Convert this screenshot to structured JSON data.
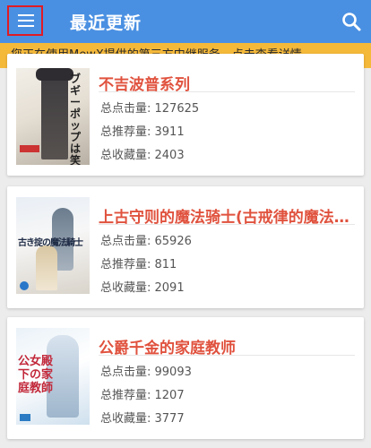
{
  "app": {
    "title": "最近更新"
  },
  "banner": {
    "text": "您正在使用MewX提供的第三方中继服务，点击查看详情。"
  },
  "labels": {
    "clicks": "总点击量: ",
    "recommends": "总推荐量: ",
    "collects": "总收藏量: "
  },
  "novels": [
    {
      "title": "不吉波普系列",
      "clicks": "127625",
      "recommends": "3911",
      "collects": "2403",
      "cover_text": "ブギーポップは笑わない"
    },
    {
      "title": "上古守则的魔法骑士(古戒律的魔法…",
      "clicks": "65926",
      "recommends": "811",
      "collects": "2091",
      "cover_text": "古き掟の魔法騎士"
    },
    {
      "title": "公爵千金的家庭教师",
      "clicks": "99093",
      "recommends": "1207",
      "collects": "3777",
      "cover_text": "公女殿下の家庭教師"
    }
  ],
  "colors": {
    "appbar": "#4a90e2",
    "banner": "#f5b93a",
    "title": "#e0523e",
    "highlight": "#e01b24"
  }
}
